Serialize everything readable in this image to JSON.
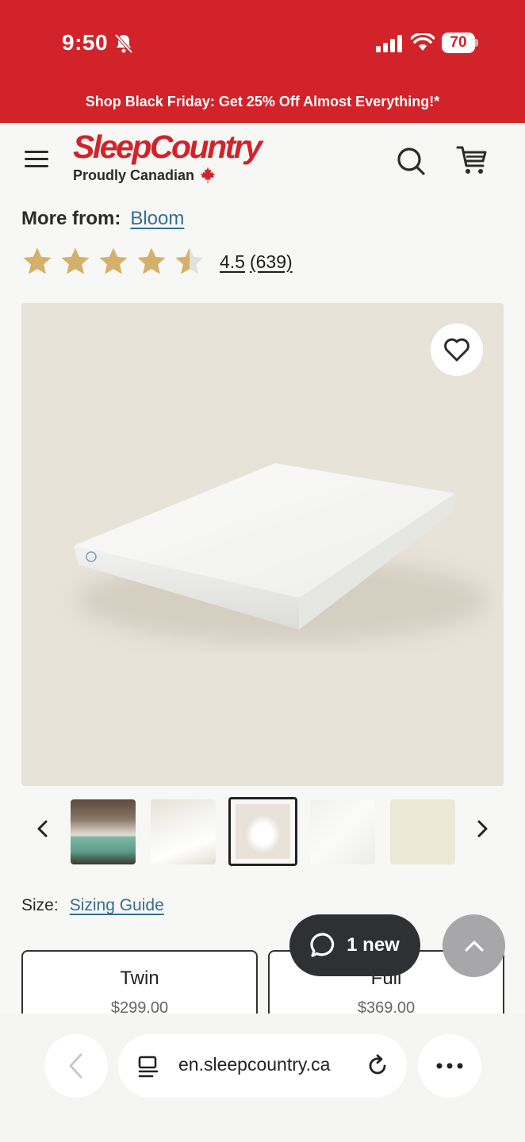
{
  "status_bar": {
    "time": "9:50",
    "battery": "70",
    "icons": [
      "bell-slash-icon",
      "signal-icon",
      "wifi-icon",
      "battery-icon"
    ]
  },
  "promo": {
    "text": "Shop Black Friday: Get 25% Off Almost Everything!*"
  },
  "header": {
    "logo_text": "SleepCountry",
    "logo_tagline": "Proudly Canadian",
    "icons": [
      "menu-icon",
      "search-icon",
      "cart-icon"
    ]
  },
  "product": {
    "more_from_label": "More from:",
    "brand": "Bloom",
    "rating_value": "4.5",
    "rating_count": "(639)",
    "rating_stars": 4.5
  },
  "gallery": {
    "thumbnail_count": 5,
    "active_index": 2
  },
  "size": {
    "label": "Size:",
    "guide_link": "Sizing Guide",
    "options": [
      {
        "name": "Twin",
        "price": "$299.00"
      },
      {
        "name": "Full",
        "price": "$369.00"
      }
    ]
  },
  "chat": {
    "label": "1 new"
  },
  "browser": {
    "url": "en.sleepcountry.ca"
  },
  "colors": {
    "brand_red": "#d2232a",
    "star_gold": "#d4b06a",
    "link_blue": "#356e8f"
  }
}
